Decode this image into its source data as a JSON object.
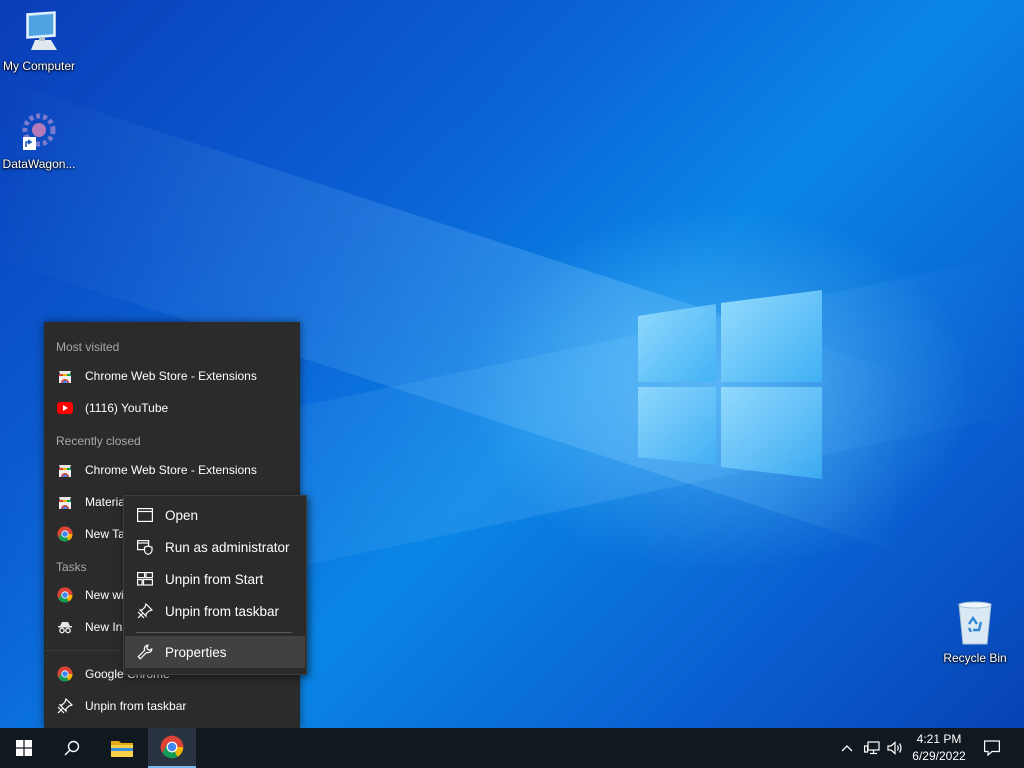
{
  "desktop": {
    "icons": [
      {
        "label": "My Computer",
        "icon": "monitor-icon"
      },
      {
        "label": "DataWagon...",
        "icon": "datawagon-shortcut-icon"
      },
      {
        "label": "Recycle Bin",
        "icon": "recycle-bin-icon"
      }
    ]
  },
  "jumplist": {
    "most_visited_heading": "Most visited",
    "most_visited": [
      {
        "label": "Chrome Web Store - Extensions",
        "icon": "chrome-web-store-icon"
      },
      {
        "label": "(1116) YouTube",
        "icon": "youtube-icon"
      }
    ],
    "recently_closed_heading": "Recently closed",
    "recently_closed": [
      {
        "label": "Chrome Web Store - Extensions",
        "icon": "chrome-web-store-icon"
      },
      {
        "label": "Materia",
        "icon": "chrome-web-store-icon"
      },
      {
        "label": "New Ta",
        "icon": "chrome-icon"
      }
    ],
    "tasks_heading": "Tasks",
    "tasks": [
      {
        "label": "New wi",
        "icon": "chrome-icon"
      },
      {
        "label": "New In",
        "icon": "incognito-icon"
      }
    ],
    "app": {
      "label": "Google Chrome",
      "icon": "chrome-icon"
    },
    "unpin": {
      "label": "Unpin from taskbar",
      "icon": "unpin-icon"
    }
  },
  "context_menu": {
    "items": [
      {
        "label": "Open",
        "icon": "window-icon"
      },
      {
        "label": "Run as administrator",
        "icon": "shield-icon"
      },
      {
        "label": "Unpin from Start",
        "icon": "unpin-start-icon"
      },
      {
        "label": "Unpin from taskbar",
        "icon": "unpin-icon"
      },
      {
        "label": "Properties",
        "icon": "wrench-icon"
      }
    ]
  },
  "taskbar": {
    "start": "windows-start-icon",
    "search": "search-icon",
    "pinned": [
      {
        "name": "file-explorer",
        "icon": "folder-icon"
      },
      {
        "name": "google-chrome",
        "icon": "chrome-icon",
        "active": true
      }
    ],
    "tray": {
      "chevron": "chevron-up-icon",
      "network": "network-icon",
      "volume": "volume-icon",
      "time": "4:21 PM",
      "date": "6/29/2022",
      "notifications": "notification-icon"
    }
  },
  "colors": {
    "accent": "#76b9ed",
    "menu_bg": "#2b2b2b",
    "taskbar_bg": "#101820",
    "desktop_blue": "#0b63d6"
  }
}
